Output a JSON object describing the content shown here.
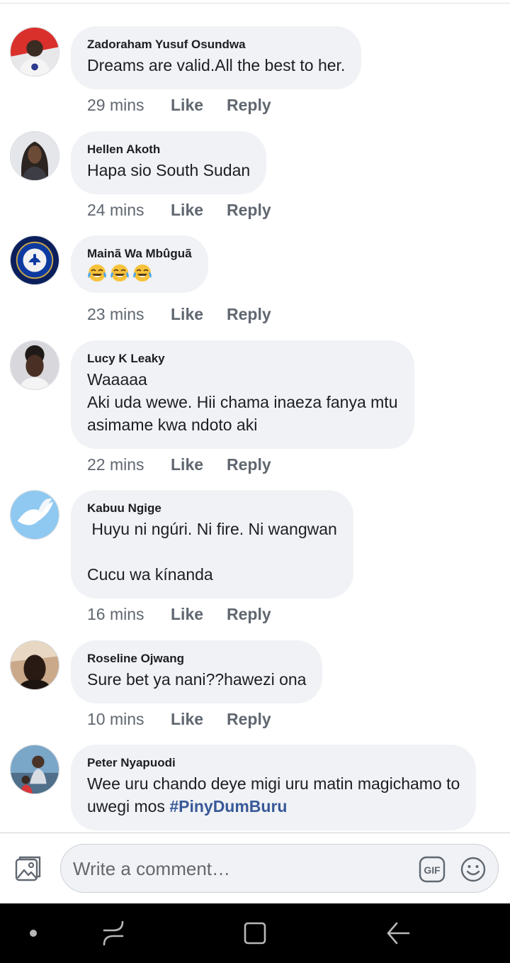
{
  "comments": [
    {
      "author": "Zadoraham Yusuf Osundwa",
      "lines": [
        "Dreams are valid.All the best to her."
      ],
      "time": "29 mins",
      "like_label": "Like",
      "reply_label": "Reply"
    },
    {
      "author": "Hellen Akoth",
      "lines": [
        "Hapa sio South Sudan"
      ],
      "time": "24 mins",
      "like_label": "Like",
      "reply_label": "Reply"
    },
    {
      "author": "Mainã Wa Mbûguã",
      "emoji": [
        "face-with-tears-of-joy-emoji",
        "face-with-tears-of-joy-emoji",
        "face-with-tears-of-joy-emoji"
      ],
      "time": "23 mins",
      "like_label": "Like",
      "reply_label": "Reply"
    },
    {
      "author": "Lucy K Leaky",
      "lines": [
        "Waaaaa",
        "Aki uda wewe. Hii chama inaeza fanya mtu",
        "asimame kwa ndoto aki"
      ],
      "time": "22 mins",
      "like_label": "Like",
      "reply_label": "Reply"
    },
    {
      "author": "Kabuu Ngige",
      "lines": [
        " Huyu ni ngúri. Ni fire. Ni wangwan",
        "",
        "Cucu wa kínanda"
      ],
      "time": "16 mins",
      "like_label": "Like",
      "reply_label": "Reply"
    },
    {
      "author": "Roseline Ojwang",
      "lines": [
        "Sure bet ya nani??hawezi ona"
      ],
      "time": "10 mins",
      "like_label": "Like",
      "reply_label": "Reply"
    },
    {
      "author": "Peter Nyapuodi",
      "lines": [
        "Wee uru chando deye migi uru matin magichamo to",
        "uwegi mos "
      ],
      "hashtag": "#PinyDumBuru"
    }
  ],
  "composer": {
    "placeholder": "Write a comment…",
    "gif_label": "GIF",
    "photo_icon": "photo-icon",
    "emoji_icon": "smiley-icon"
  },
  "navbar": {
    "icons": [
      "dot-icon",
      "recent-apps-icon",
      "home-icon",
      "back-icon"
    ]
  },
  "colors": {
    "bubble": "#f0f2f5",
    "meta_text": "#606770",
    "hashtag": "#385898",
    "navbar": "#000000"
  }
}
